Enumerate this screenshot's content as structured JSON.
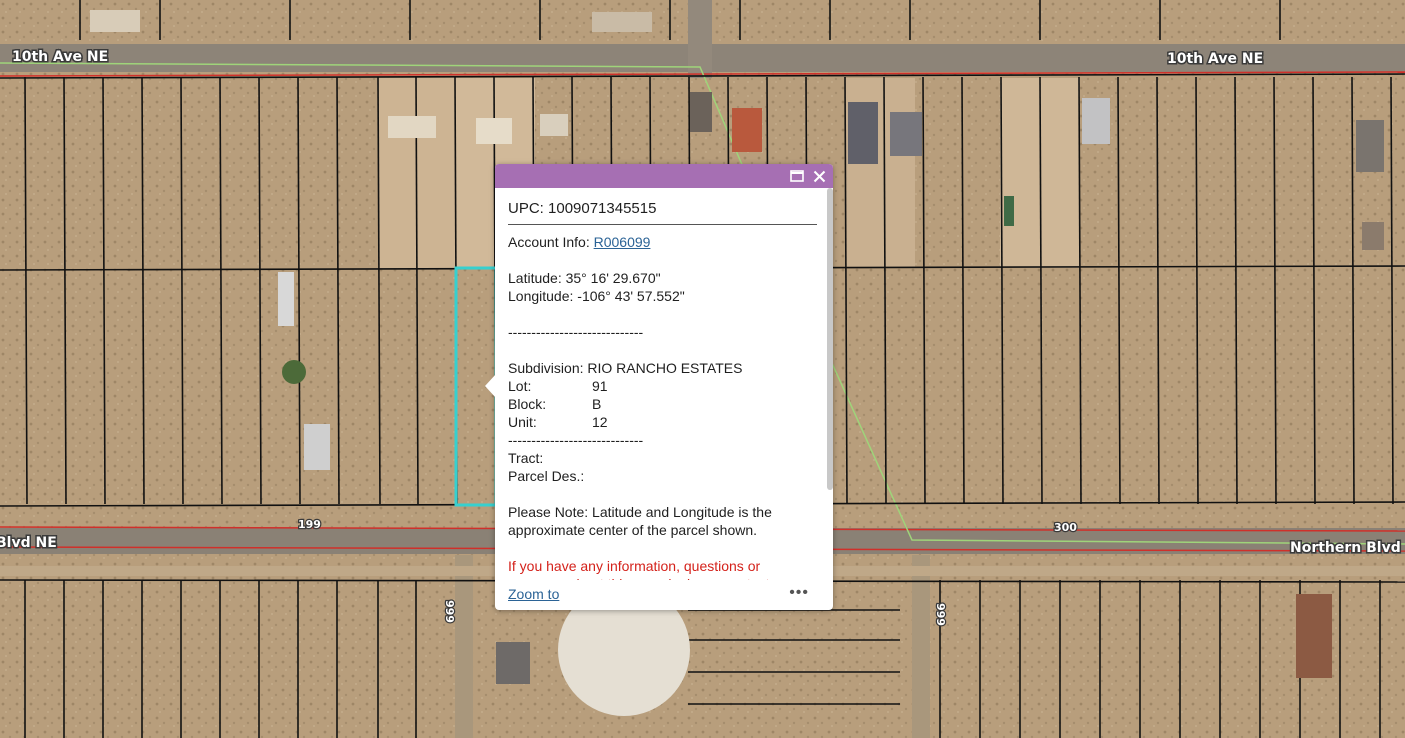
{
  "map": {
    "road_labels": {
      "tenth_left": "10th Ave NE",
      "tenth_right": "10th Ave NE",
      "northern_left": "Blvd NE",
      "northern_right": "Northern Blvd"
    },
    "address_labels": {
      "a199": "199",
      "a300": "300",
      "a999_left": "999",
      "a999_right": "999"
    },
    "colors": {
      "parcel_line": "#111111",
      "boundary_red": "#d0302a",
      "boundary_green": "#9fd47a",
      "selected_parcel": "#36d0cf",
      "popup_header": "#a66fb3"
    }
  },
  "popup": {
    "header_icons": {
      "maximize": "maximize-icon",
      "close": "close-icon"
    },
    "upc": "UPC: 1009071345515",
    "account_label": "Account Info: ",
    "account_value": "R006099",
    "latitude": "Latitude: 35° 16' 29.670\"",
    "longitude": "Longitude: -106° 43' 57.552\"",
    "separator": "-----------------------------",
    "subdivision": "Subdivision: RIO RANCHO ESTATES",
    "lot_label": "Lot:",
    "lot_value": "91",
    "block_label": "Block:",
    "block_value": "B",
    "unit_label": "Unit:",
    "unit_value": "12",
    "tract": "Tract:",
    "parcel_des": "Parcel Des.:",
    "note": "Please Note: Latitude and Longitude is the approximate center of the parcel shown.",
    "red_text": "If you have any information, questions or concerns about this parcel, please contact",
    "zoom_to": "Zoom to",
    "more": "•••"
  }
}
